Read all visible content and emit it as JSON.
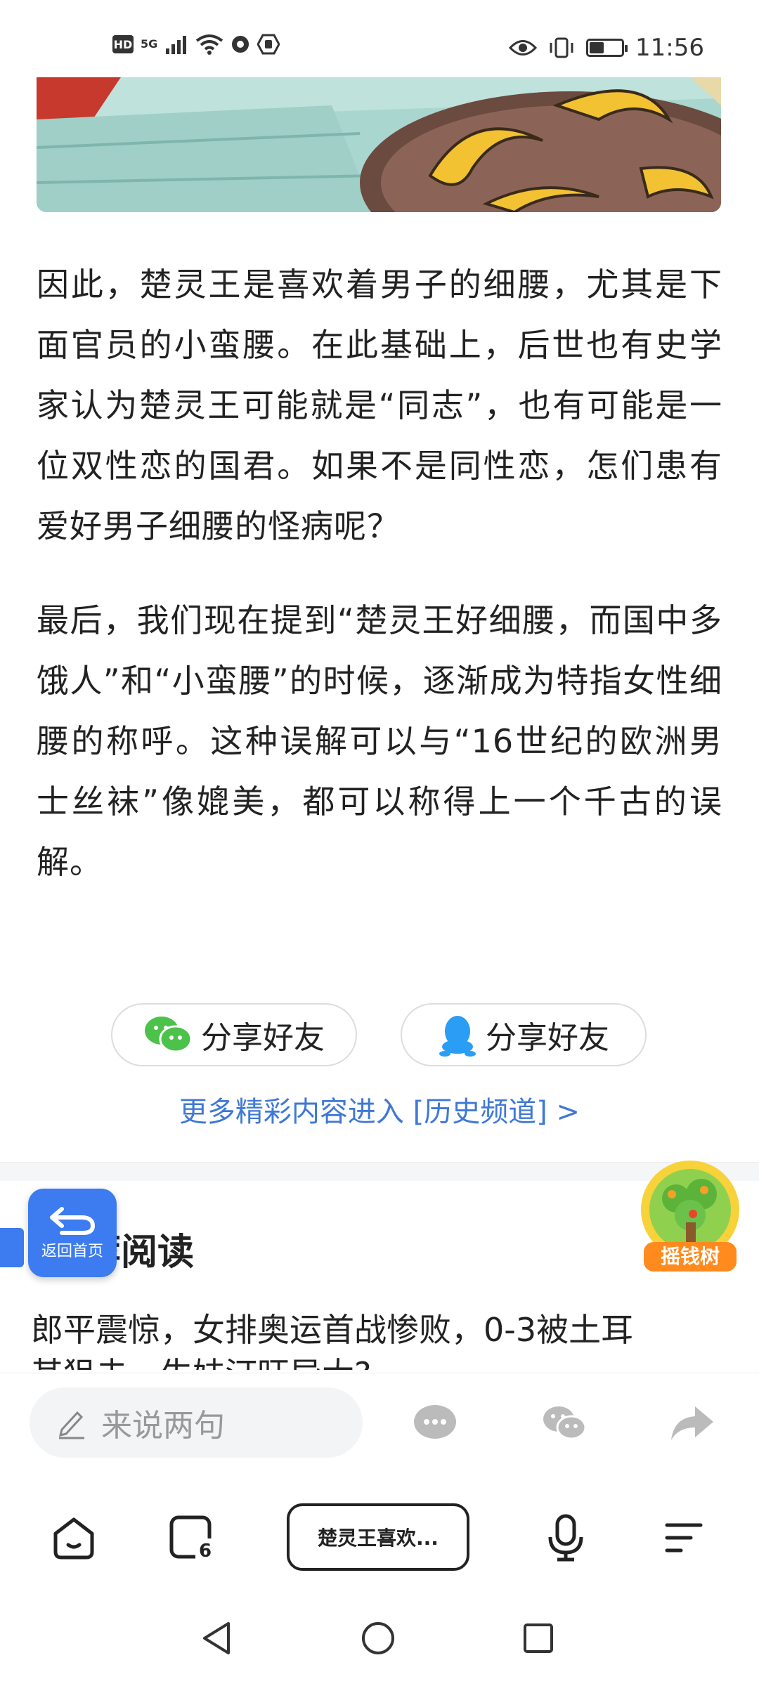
{
  "status_bar": {
    "hd": "HD",
    "network": "5G",
    "time": "11:56",
    "battery_level": 0.45
  },
  "article": {
    "paragraphs": [
      "因此，楚灵王是喜欢着男子的细腰，尤其是下面官员的小蛮腰。在此基础上，后世也有史学家认为楚灵王可能就是“同志”，也有可能是一位双性恋的国君。如果不是同性恋，怎们患有爱好男子细腰的怪病呢？",
      "最后，我们现在提到“楚灵王好细腰，而国中多饿人”和“小蛮腰”的时候，逐渐成为特指女性细腰的称呼。这种误解可以与“16世纪的欧洲男士丝袜”像媲美，都可以称得上一个千古的误解。"
    ]
  },
  "share": {
    "wechat_label": "分享好友",
    "qq_label": "分享好友"
  },
  "more_link": "更多精彩内容进入 [历史频道] >",
  "recommend": {
    "title": "推荐阅读",
    "title_visible": "荐阅读",
    "items": [
      "郎平震惊，女排奥运首战惨败，0-3被土耳",
      "其狙击，生妹汀旺异大?"
    ]
  },
  "floating": {
    "back_home_label": "返回首页",
    "money_tree_label": "摇钱树"
  },
  "comment_bar": {
    "placeholder": "来说两句"
  },
  "toolbar": {
    "tab_count": "6",
    "current_title": "楚灵王喜欢..."
  },
  "colors": {
    "accent": "#3c7cf0",
    "link": "#3f78d6",
    "wechat_green": "#4cc24a",
    "qq_blue": "#2a9df4"
  }
}
